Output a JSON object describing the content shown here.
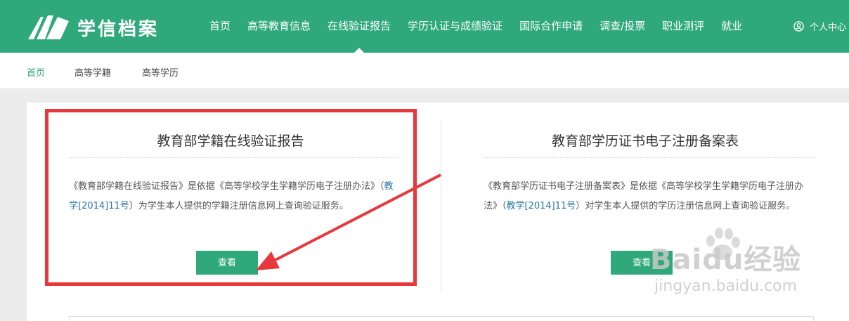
{
  "header": {
    "logo_text": "学信档案",
    "nav": [
      {
        "label": "首页"
      },
      {
        "label": "高等教育信息"
      },
      {
        "label": "在线验证报告",
        "active": true
      },
      {
        "label": "学历认证与成绩验证"
      },
      {
        "label": "国际合作申请"
      },
      {
        "label": "调查/投票"
      },
      {
        "label": "职业测评"
      },
      {
        "label": "就业"
      }
    ],
    "user_center": "个人中心"
  },
  "subnav": {
    "items": [
      "首页",
      "高等学籍",
      "高等学历"
    ]
  },
  "cards": [
    {
      "title": "教育部学籍在线验证报告",
      "desc_pre": "《教育部学籍在线验证报告》是依据《高等学校学生学籍学历电子注册办法》（",
      "desc_link": "教学[2014]11号",
      "desc_post": "）为学生本人提供的学籍注册信息网上查询验证服务。",
      "button": "查看"
    },
    {
      "title": "教育部学历证书电子注册备案表",
      "desc_pre": "《教育部学历证书电子注册备案表》是依据《高等学校学生学籍学历电子注册办法》（",
      "desc_link": "教学[2014]11号",
      "desc_post": "）对学生本人提供的学历注册信息网上查询验证服务。",
      "button": "查看"
    }
  ],
  "watermark": {
    "brand": "Baidu经验",
    "url": "jingyan.baidu.com"
  },
  "colors": {
    "brand_green": "#2fa97c",
    "highlight_red": "#e8383d",
    "link_blue": "#2874a6"
  }
}
